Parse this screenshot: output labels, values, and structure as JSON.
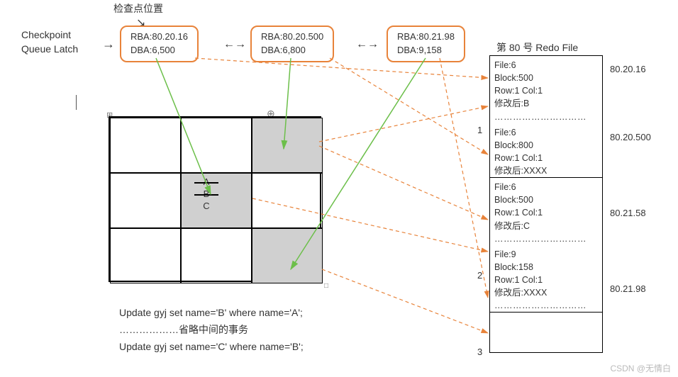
{
  "checkpoint_label": "检查点位置",
  "left_label_line1": "Checkpoint",
  "left_label_line2": "Queue Latch",
  "queue": [
    {
      "rba": "RBA:80.20.16",
      "dba": "DBA:6,500"
    },
    {
      "rba": "RBA:80.20.500",
      "dba": "DBA:6,800"
    },
    {
      "rba": "RBA:80.21.98",
      "dba": "DBA:9,158"
    }
  ],
  "cell_letters": {
    "a": "A",
    "b": "B",
    "c": "C"
  },
  "sql": {
    "line1": "Update gyj set name='B' where name='A';",
    "line2": "………………省略中间的事务",
    "line3": "Update gyj set name='C' where name='B';"
  },
  "redo_title": "第 80 号 Redo File",
  "redo_entries": [
    {
      "file": "File:6",
      "block": "Block:500",
      "row": "Row:1 Col:1",
      "after": "修改后:B",
      "dots": "…………………………"
    },
    {
      "file": "File:6",
      "block": "Block:800",
      "row": "Row:1 Col:1",
      "after": "修改后:XXXX",
      "dots": ""
    },
    {
      "file": "File:6",
      "block": "Block:500",
      "row": "Row:1 Col:1",
      "after": "修改后:C",
      "dots": "…………………………"
    },
    {
      "file": "File:9",
      "block": "Block:158",
      "row": "Row:1 Col:1",
      "after": "修改后:XXXX",
      "dots": "…………………………"
    }
  ],
  "side_rba": [
    "80.20.16",
    "80.20.500",
    "80.21.58",
    "80.21.98"
  ],
  "side_idx": [
    "1",
    "2",
    "3"
  ],
  "watermark": "CSDN @无情白"
}
